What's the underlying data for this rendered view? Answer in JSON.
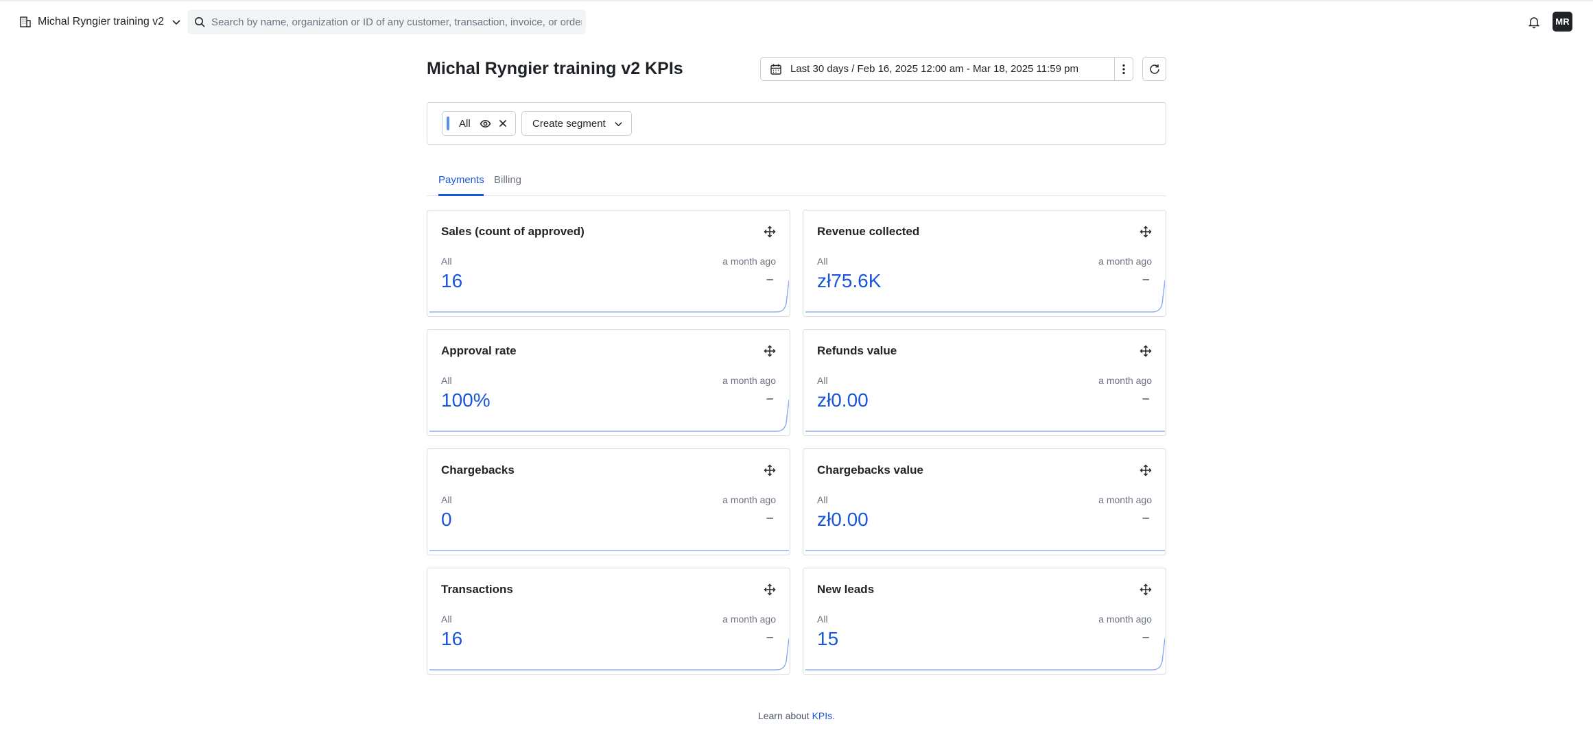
{
  "header": {
    "org_name": "Michal Ryngier training v2",
    "search_placeholder": "Search by name, organization or ID of any customer, transaction, invoice, or order",
    "avatar_initials": "MR"
  },
  "page": {
    "title": "Michal Ryngier training v2 KPIs",
    "date_range": "Last 30 days / Feb 16, 2025 12:00 am - Mar 18, 2025 11:59 pm"
  },
  "segments": {
    "active_chip": "All",
    "create_label": "Create segment"
  },
  "tabs": [
    {
      "label": "Payments",
      "active": true
    },
    {
      "label": "Billing",
      "active": false
    }
  ],
  "cards": [
    {
      "title": "Sales (count of approved)",
      "segment": "All",
      "timestamp": "a month ago",
      "value": "16",
      "delta": "–",
      "trend": "rising"
    },
    {
      "title": "Revenue collected",
      "segment": "All",
      "timestamp": "a month ago",
      "value": "zł75.6K",
      "delta": "–",
      "trend": "rising"
    },
    {
      "title": "Approval rate",
      "segment": "All",
      "timestamp": "a month ago",
      "value": "100%",
      "delta": "–",
      "trend": "rising"
    },
    {
      "title": "Refunds value",
      "segment": "All",
      "timestamp": "a month ago",
      "value": "zł0.00",
      "delta": "–",
      "trend": "flat"
    },
    {
      "title": "Chargebacks",
      "segment": "All",
      "timestamp": "a month ago",
      "value": "0",
      "delta": "–",
      "trend": "flat"
    },
    {
      "title": "Chargebacks value",
      "segment": "All",
      "timestamp": "a month ago",
      "value": "zł0.00",
      "delta": "–",
      "trend": "flat"
    },
    {
      "title": "Transactions",
      "segment": "All",
      "timestamp": "a month ago",
      "value": "16",
      "delta": "–",
      "trend": "rising"
    },
    {
      "title": "New leads",
      "segment": "All",
      "timestamp": "a month ago",
      "value": "15",
      "delta": "–",
      "trend": "rising"
    }
  ],
  "footer": {
    "prefix": "Learn about ",
    "link_label": "KPIs",
    "suffix": "."
  },
  "colors": {
    "accent": "#1a56db",
    "chip_accent": "#5b8def",
    "sparkline": "#8fb0ee"
  }
}
